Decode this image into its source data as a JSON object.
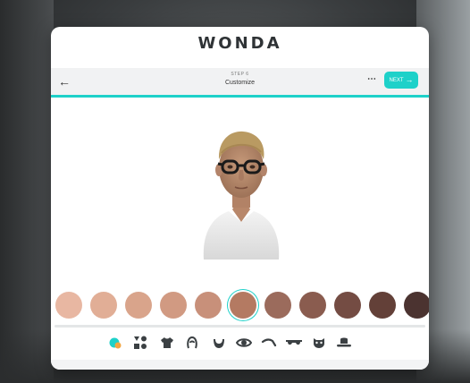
{
  "brand": {
    "logo_text": "WONDA"
  },
  "header": {
    "step_label": "STEP 6",
    "title": "Customize",
    "next_label": "NEXT",
    "accent_color": "#1ed1c9"
  },
  "skin_tones": {
    "selected_index": 5,
    "colors": [
      "#e8b7a2",
      "#e1ae96",
      "#d9a48b",
      "#d19a82",
      "#c8907a",
      "#b47a62",
      "#9b6b5c",
      "#8a5c4f",
      "#744c43",
      "#634038",
      "#4b3330"
    ]
  },
  "categories": [
    {
      "name": "skin-tone-icon",
      "active": true
    },
    {
      "name": "shapes-icon",
      "active": false
    },
    {
      "name": "shirt-icon",
      "active": false
    },
    {
      "name": "hair-icon",
      "active": false
    },
    {
      "name": "beard-icon",
      "active": false
    },
    {
      "name": "eye-icon",
      "active": false
    },
    {
      "name": "eyebrow-icon",
      "active": false
    },
    {
      "name": "glasses-icon",
      "active": false
    },
    {
      "name": "mask-icon",
      "active": false
    },
    {
      "name": "hat-icon",
      "active": false
    }
  ]
}
